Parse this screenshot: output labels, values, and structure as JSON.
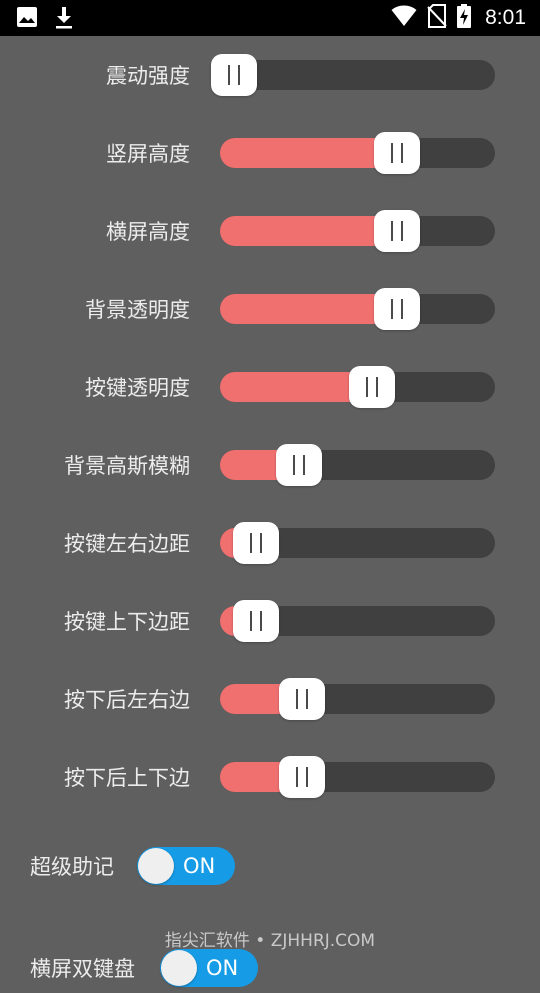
{
  "status_bar": {
    "time": "8:01",
    "icons": [
      "image-icon",
      "download-icon",
      "wifi-icon",
      "no-sim-icon",
      "battery-charging-icon"
    ]
  },
  "sliders": [
    {
      "label": "震动强度",
      "value": 0.02
    },
    {
      "label": "竖屏高度",
      "value": 0.69
    },
    {
      "label": "横屏高度",
      "value": 0.69
    },
    {
      "label": "背景透明度",
      "value": 0.69
    },
    {
      "label": "按键透明度",
      "value": 0.59
    },
    {
      "label": "背景高斯模糊",
      "value": 0.29
    },
    {
      "label": "按键左右边距",
      "value": 0.11
    },
    {
      "label": "按键上下边距",
      "value": 0.11
    },
    {
      "label": "按下后左右边",
      "value": 0.3
    },
    {
      "label": "按下后上下边",
      "value": 0.3
    }
  ],
  "toggles": [
    {
      "label": "超级助记",
      "state": "ON"
    },
    {
      "label": "横屏双键盘",
      "state": "ON"
    }
  ],
  "watermark": "指尖汇软件 • ZJHHRJ.COM",
  "colors": {
    "background": "#5f5f5f",
    "track": "#404040",
    "fill": "#f07070",
    "switch_on": "#169be6"
  }
}
